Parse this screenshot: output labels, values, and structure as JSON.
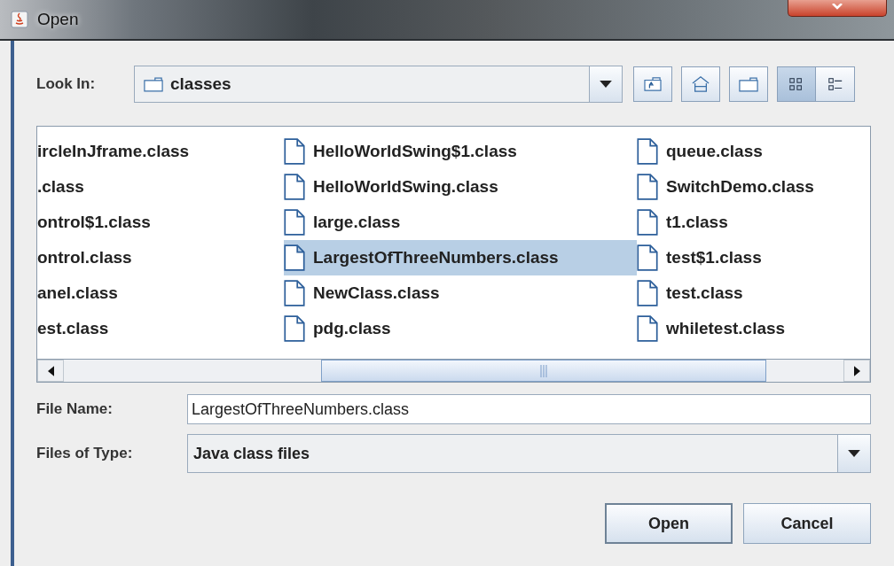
{
  "window": {
    "title": "Open"
  },
  "look_in": {
    "label": "Look In:",
    "value": "classes"
  },
  "toolbar": [
    {
      "kind": "up",
      "selected": false
    },
    {
      "kind": "home",
      "selected": false
    },
    {
      "kind": "new-folder",
      "selected": false
    },
    {
      "kind": "list",
      "selected": true
    },
    {
      "kind": "details",
      "selected": false
    }
  ],
  "file_list": {
    "columns": [
      {
        "icons": false,
        "items": [
          {
            "name": "ircleInJframe.class",
            "selected": false
          },
          {
            "name": ".class",
            "selected": false
          },
          {
            "name": "ontrol$1.class",
            "selected": false
          },
          {
            "name": "ontrol.class",
            "selected": false
          },
          {
            "name": "anel.class",
            "selected": false
          },
          {
            "name": "est.class",
            "selected": false
          }
        ]
      },
      {
        "icons": true,
        "items": [
          {
            "name": "HelloWorldSwing$1.class",
            "selected": false
          },
          {
            "name": "HelloWorldSwing.class",
            "selected": false
          },
          {
            "name": "large.class",
            "selected": false
          },
          {
            "name": "LargestOfThreeNumbers.class",
            "selected": true
          },
          {
            "name": "NewClass.class",
            "selected": false
          },
          {
            "name": "pdg.class",
            "selected": false
          }
        ]
      },
      {
        "icons": true,
        "items": [
          {
            "name": "queue.class",
            "selected": false
          },
          {
            "name": "SwitchDemo.class",
            "selected": false
          },
          {
            "name": "t1.class",
            "selected": false
          },
          {
            "name": "test$1.class",
            "selected": false
          },
          {
            "name": "test.class",
            "selected": false
          },
          {
            "name": "whiletest.class",
            "selected": false
          }
        ]
      }
    ]
  },
  "file_name": {
    "label": "File Name:",
    "value": "LargestOfThreeNumbers.class"
  },
  "files_of_type": {
    "label": "Files of Type:",
    "value": "Java class files"
  },
  "buttons": [
    {
      "label": "Open",
      "default": true
    },
    {
      "label": "Cancel",
      "default": false
    }
  ]
}
